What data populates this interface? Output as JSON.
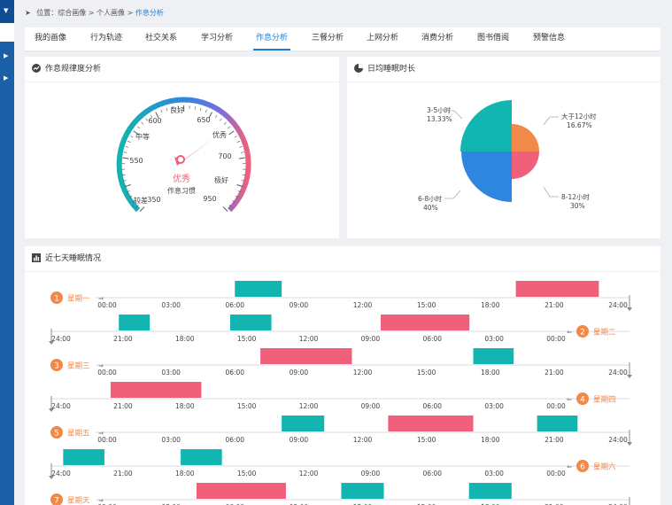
{
  "breadcrumb": {
    "prefix": "位置：综合画像",
    "sep1": ">",
    "mid": "个人画像",
    "sep2": ">",
    "current": "作息分析"
  },
  "tabs": [
    "我的画像",
    "行为轨迹",
    "社交关系",
    "学习分析",
    "作息分析",
    "三餐分析",
    "上网分析",
    "消费分析",
    "图书借阅",
    "预警信息"
  ],
  "active_tab": "作息分析",
  "gauge_panel": {
    "title": "作息规律度分析",
    "ticks": [
      "350",
      "较差",
      "550",
      "中等",
      "600",
      "良好",
      "650",
      "优秀",
      "700",
      "极好",
      "950"
    ],
    "value_label": "优秀",
    "caption": "作息习惯",
    "pointer_level": "优秀"
  },
  "pie_panel": {
    "title": "日均睡眠时长",
    "slices": [
      {
        "name": "3-5小时",
        "pct": "13.33%",
        "value": 13.33,
        "color": "#2f86e0"
      },
      {
        "name": "大于12小时",
        "pct": "16.67%",
        "value": 16.67,
        "color": "#f0894a"
      },
      {
        "name": "8-12小时",
        "pct": "30%",
        "value": 30,
        "color": "#f0607a"
      },
      {
        "name": "6-8小时",
        "pct": "40%",
        "value": 40,
        "color": "#12b5b0"
      }
    ]
  },
  "sleep_panel": {
    "title": "近七天睡眠情况",
    "hours_forward": [
      "00:00",
      "03:00",
      "06:00",
      "09:00",
      "12:00",
      "15:00",
      "18:00",
      "21:00",
      "24:00"
    ],
    "hours_reverse": [
      "24:00",
      "21:00",
      "18:00",
      "15:00",
      "12:00",
      "09:00",
      "06:00",
      "03:00",
      "00:00"
    ],
    "days": [
      {
        "num": "1",
        "name": "星期一",
        "blocks": [
          {
            "start": 6,
            "end": 8.2,
            "type": "teal"
          },
          {
            "start": 19.2,
            "end": 23.1,
            "type": "pink"
          }
        ]
      },
      {
        "num": "2",
        "name": "星期二",
        "blocks": [
          {
            "start": 19.7,
            "end": 21.2,
            "type": "teal"
          },
          {
            "start": 13.8,
            "end": 15.8,
            "type": "teal"
          },
          {
            "start": 4.2,
            "end": 8.5,
            "type": "pink"
          }
        ]
      },
      {
        "num": "3",
        "name": "星期三",
        "blocks": [
          {
            "start": 7.2,
            "end": 11.5,
            "type": "pink"
          },
          {
            "start": 17.2,
            "end": 19.1,
            "type": "teal"
          }
        ]
      },
      {
        "num": "4",
        "name": "星期四",
        "blocks": [
          {
            "start": 17.2,
            "end": 21.6,
            "type": "pink"
          }
        ]
      },
      {
        "num": "5",
        "name": "星期五",
        "blocks": [
          {
            "start": 8.2,
            "end": 10.2,
            "type": "teal"
          },
          {
            "start": 13.2,
            "end": 17.2,
            "type": "pink"
          },
          {
            "start": 20.2,
            "end": 22.1,
            "type": "teal"
          }
        ]
      },
      {
        "num": "6",
        "name": "星期六",
        "blocks": [
          {
            "start": 21.9,
            "end": 23.9,
            "type": "teal"
          },
          {
            "start": 16.2,
            "end": 18.2,
            "type": "teal"
          }
        ]
      },
      {
        "num": "7",
        "name": "星期天",
        "blocks": [
          {
            "start": 4.2,
            "end": 8.4,
            "type": "pink"
          },
          {
            "start": 11,
            "end": 13,
            "type": "teal"
          },
          {
            "start": 17,
            "end": 19,
            "type": "teal"
          }
        ]
      }
    ]
  },
  "colors": {
    "teal": "#12b5b0",
    "pink": "#f0607a",
    "orange": "#f0894a",
    "blue": "#2f86e0",
    "accent": "#1e7fd8"
  }
}
